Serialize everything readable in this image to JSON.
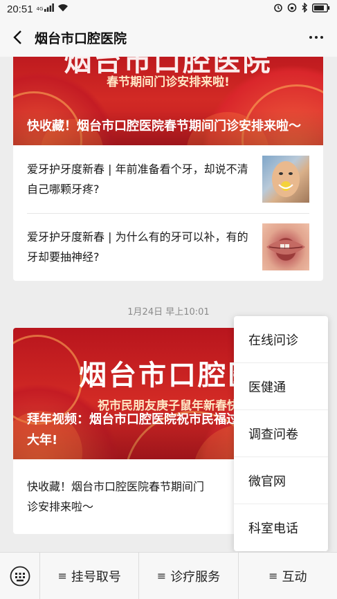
{
  "status_bar": {
    "time": "20:51",
    "network": "4G",
    "icons": [
      "signal-icon",
      "wifi-icon",
      "alarm-icon",
      "lock-rotation-icon",
      "bluetooth-icon",
      "battery-icon"
    ]
  },
  "header": {
    "title": "烟台市口腔医院",
    "back_icon": "back-arrow-icon",
    "more_icon": "more-dots-icon"
  },
  "feed": {
    "card1": {
      "banner_big_text": "烟台市口腔医院",
      "banner_sub_text": "春节期间门诊安排来啦!",
      "caption": "快收藏！烟台市口腔医院春节期间门诊安排来啦～",
      "articles": [
        {
          "title": "爱牙护牙度新春 | 年前准备看个牙，却说不清自己哪颗牙疼?",
          "thumbnail": "man-biting-lemon-image"
        },
        {
          "title": "爱牙护牙度新春 | 为什么有的牙可以补，有的牙却要抽神经?",
          "thumbnail": "lips-teeth-image"
        }
      ]
    },
    "date": "1月24日 早上10:01",
    "card2": {
      "banner_big_text": "烟台市口腔医",
      "banner_sub_text": "祝市民朋友庚子鼠年新春快",
      "caption": "拜年视频：烟台市口腔医院祝市民福过大年!",
      "articles": [
        {
          "title": "快收藏！烟台市口腔医院春节期间门诊安排来啦～"
        }
      ]
    }
  },
  "popup_menu": {
    "items": [
      "在线问诊",
      "医健通",
      "调查问卷",
      "微官网",
      "科室电话"
    ]
  },
  "bottom_bar": {
    "keyboard_icon": "keyboard-icon",
    "menu_glyph": "≡",
    "buttons": [
      "挂号取号",
      "诊疗服务",
      "互动"
    ]
  },
  "colors": {
    "banner_red": "#c41c24",
    "background": "#ededed"
  }
}
